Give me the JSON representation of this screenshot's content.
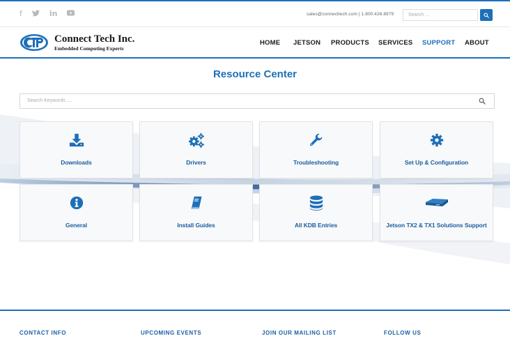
{
  "topbar": {
    "social_icons": [
      "facebook-icon",
      "twitter-icon",
      "linkedin-icon",
      "youtube-icon"
    ],
    "contact_text": "sales@connecttech.com | 1.800.426.8979",
    "search_placeholder": "Search ..."
  },
  "header": {
    "logo_title": "Connect Tech Inc.",
    "logo_subtitle": "Embedded Computing Experts",
    "nav": [
      {
        "label": "HOME",
        "active": false
      },
      {
        "label": "JETSON",
        "active": false
      },
      {
        "label": "PRODUCTS",
        "active": false
      },
      {
        "label": "SERVICES",
        "active": false
      },
      {
        "label": "SUPPORT",
        "active": true
      },
      {
        "label": "ABOUT",
        "active": false
      }
    ]
  },
  "main": {
    "title": "Resource Center",
    "search_placeholder": "Search Keywords ....",
    "cards": [
      {
        "label": "Downloads",
        "icon": "download-icon"
      },
      {
        "label": "Drivers",
        "icon": "cogs-icon"
      },
      {
        "label": "Troubleshooting",
        "icon": "wrench-icon"
      },
      {
        "label": "Set Up & Configuration",
        "icon": "gear-icon"
      },
      {
        "label": "General",
        "icon": "info-icon"
      },
      {
        "label": "Install Guides",
        "icon": "book-icon"
      },
      {
        "label": "All KDB Entries",
        "icon": "database-icon"
      },
      {
        "label": "Jetson TX2 & TX1 Solutions Support",
        "icon": "board-icon"
      }
    ]
  },
  "footer": {
    "headings": [
      "CONTACT INFO",
      "UPCOMING EVENTS",
      "JOIN OUR MAILING LIST",
      "FOLLOW US"
    ]
  },
  "colors": {
    "accent": "#1d6fb8",
    "card_label": "#1d5fa0"
  }
}
